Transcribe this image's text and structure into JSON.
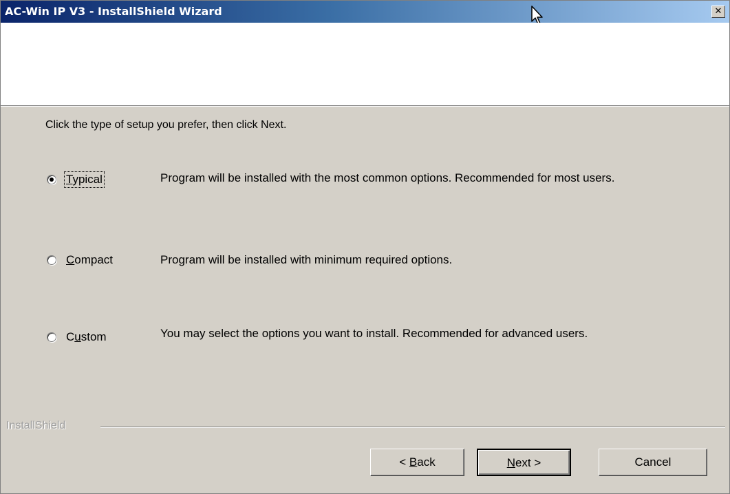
{
  "window": {
    "title": "AC-Win IP V3  - InstallShield Wizard",
    "close_glyph": "✕"
  },
  "instruction": "Click the type of setup you prefer, then click Next.",
  "options": [
    {
      "label_pre": "",
      "label_u": "T",
      "label_post": "ypical",
      "description": "Program will be installed with the most common options.  Recommended for most users.",
      "selected": true
    },
    {
      "label_pre": "",
      "label_u": "C",
      "label_post": "ompact",
      "description": "Program will be installed with minimum required options.",
      "selected": false
    },
    {
      "label_pre": "C",
      "label_u": "u",
      "label_post": "stom",
      "description": "You may select the options you want to install. Recommended for advanced users.",
      "selected": false
    }
  ],
  "brand": "InstallShield",
  "buttons": {
    "back": {
      "pre": "< ",
      "u": "B",
      "post": "ack"
    },
    "next": {
      "pre": "",
      "u": "N",
      "post": "ext >"
    },
    "cancel": "Cancel"
  },
  "colors": {
    "title_start": "#0a246a",
    "title_end": "#a6caf0",
    "face": "#d4d0c8"
  },
  "icons": {
    "close": "close-icon",
    "cursor": "mouse-pointer-icon"
  }
}
